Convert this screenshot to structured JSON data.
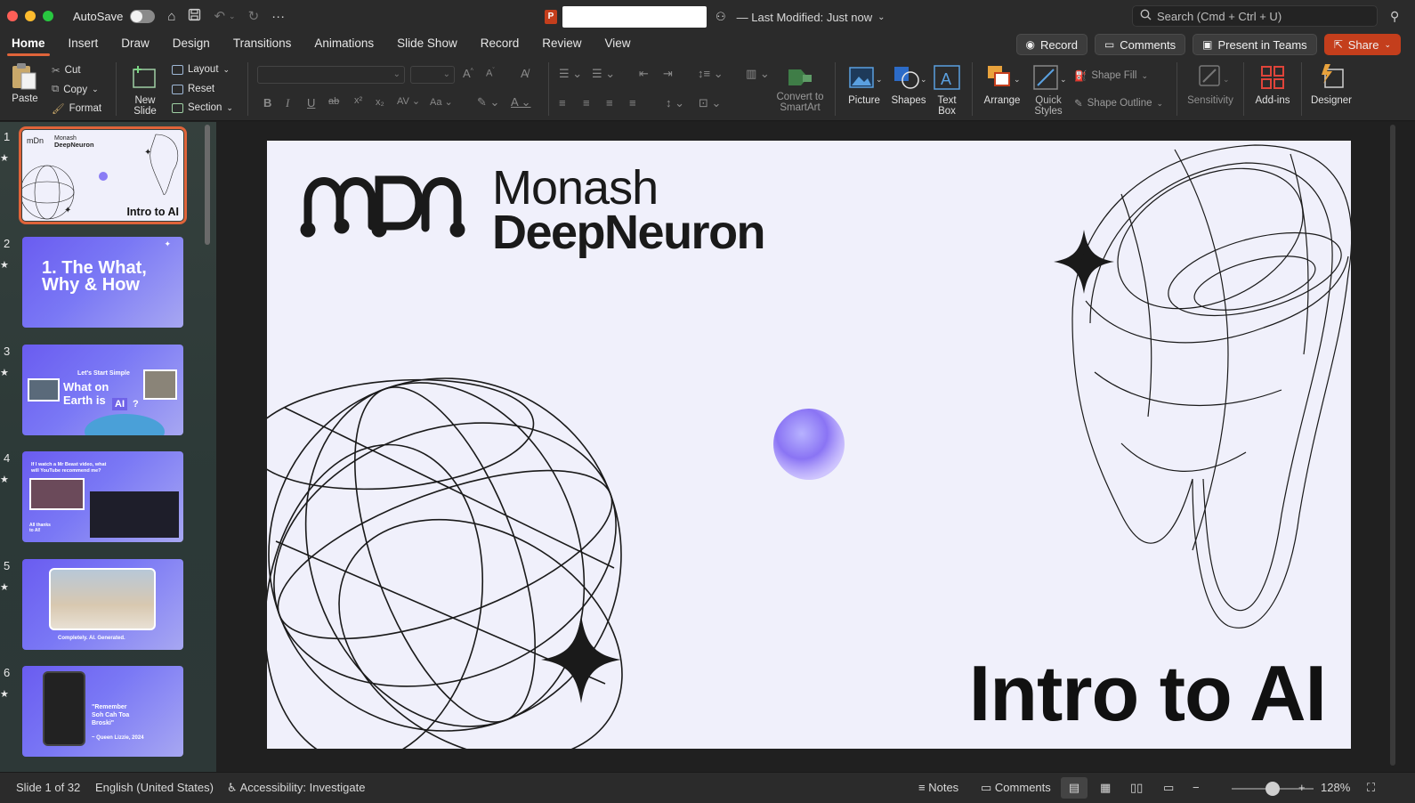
{
  "titlebar": {
    "autosave_label": "AutoSave",
    "last_modified": "— Last Modified: Just now",
    "search_placeholder": "Search (Cmd + Ctrl + U)"
  },
  "ribbon_tabs": [
    "Home",
    "Insert",
    "Draw",
    "Design",
    "Transitions",
    "Animations",
    "Slide Show",
    "Record",
    "Review",
    "View"
  ],
  "active_tab": "Home",
  "right_buttons": {
    "record": "Record",
    "comments": "Comments",
    "present": "Present in Teams",
    "share": "Share"
  },
  "ribbon": {
    "paste": "Paste",
    "cut": "Cut",
    "copy": "Copy",
    "format": "Format",
    "new_slide_1": "New",
    "new_slide_2": "Slide",
    "layout": "Layout",
    "reset": "Reset",
    "section": "Section",
    "convert_1": "Convert to",
    "convert_2": "SmartArt",
    "picture": "Picture",
    "shapes": "Shapes",
    "textbox_1": "Text",
    "textbox_2": "Box",
    "arrange": "Arrange",
    "quick_1": "Quick",
    "quick_2": "Styles",
    "shape_fill": "Shape Fill",
    "shape_outline": "Shape Outline",
    "sensitivity": "Sensitivity",
    "addins": "Add-ins",
    "designer": "Designer"
  },
  "thumbnails": [
    {
      "num": "1",
      "title": "Intro to AI",
      "brand1": "Monash",
      "brand2": "DeepNeuron"
    },
    {
      "num": "2",
      "line1": "1. The What,",
      "line2": "Why & How"
    },
    {
      "num": "3",
      "kicker": "Let's Start Simple",
      "line1": "What on",
      "line2": "Earth is",
      "badge": "AI",
      "q": "?"
    },
    {
      "num": "4",
      "line1": "If I watch a Mr Beast video, what",
      "line2": "will YouTube recommend me?",
      "note1": "All thanks",
      "note2": "to AI!"
    },
    {
      "num": "5",
      "caption": "Completely. AI. Generated."
    },
    {
      "num": "6",
      "quote1": "\"Remember",
      "quote2": "Soh Cah Toa",
      "quote3": "Broski\"",
      "attrib": "~ Queen Lizzie, 2024"
    }
  ],
  "slide": {
    "logo_mark": "MDN",
    "brand_line1": "Monash",
    "brand_line2": "DeepNeuron",
    "title": "Intro to AI"
  },
  "statusbar": {
    "slide_info": "Slide 1 of 32",
    "language": "English (United States)",
    "accessibility": "Accessibility: Investigate",
    "notes": "Notes",
    "comments": "Comments",
    "zoom": "128%",
    "zoom_value": 0.5
  }
}
